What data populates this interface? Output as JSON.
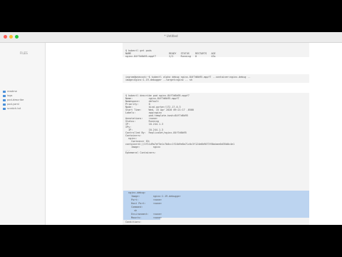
{
  "window": {
    "title": "* Untitled"
  },
  "colors": {
    "close": "#fe5f57",
    "minimize": "#febb2e",
    "zoom": "#28c840",
    "accent": "#4a90d9"
  },
  "sidebar": {
    "title": "FILES",
    "items": [
      {
        "label": "readme",
        "icon": "file-icon"
      },
      {
        "label": "logs",
        "icon": "folder-icon"
      },
      {
        "label": "pod-describe",
        "icon": "file-icon"
      },
      {
        "label": "pod-yaml",
        "icon": "file-icon"
      },
      {
        "label": "scratch.txt",
        "icon": "file-icon"
      }
    ]
  },
  "blocks": [
    {
      "lines": [
        "$ kubectl get pods",
        "NAME                          READY   STATUS    RESTARTS   AGE",
        "nginx-84f7d6b95-mppf7         2/2     Running   0          43s"
      ]
    },
    {
      "lines": [
        "ingram@peacock:~$ kubectl alpha debug nginx-84f7d6b95-mppf7 --container=nginx-debug --",
        "image=nginx:1.19-debugger --target=nginx -- sh"
      ]
    },
    {
      "lines": [
        "$ kubectl describe pod nginx-84f7d6b95-mppf7",
        "Name:           nginx-84f7d6b95-mppf7",
        "Namespace:      default",
        "Priority:       0",
        "Node:           kind-worker/172.17.0.3",
        "Start Time:     Wed, 15 Apr 2020 09:21:17 -0500",
        "Labels:         app=nginx",
        "                pod-template-hash=84f7d6b95",
        "Annotations:    <none>",
        "Status:         Running",
        "IP:             10.244.1.3",
        "IPs:",
        "  IP:           10.244.1.3",
        "Controlled By:  ReplicaSet/nginx-84f7d6b95",
        "Containers:",
        "  nginx:",
        "    Container ID:",
        "containerd://2f11d9a7ef5e1c7b0cc1f24b9e8a71c0c3f124e6b9073f8bdaee0d35b8c4e1",
        "    Image:         nginx",
        "...",
        "Ephemeral Containers:",
        "  nginx-debug:",
        "    Image:         nginx:1.19-debugger",
        "    Port:          <none>",
        "    Host Port:     <none>",
        "    Command:",
        "      sh",
        "    Environment:   <none>",
        "    Mounts:        <none>",
        "Conditions:"
      ]
    }
  ]
}
